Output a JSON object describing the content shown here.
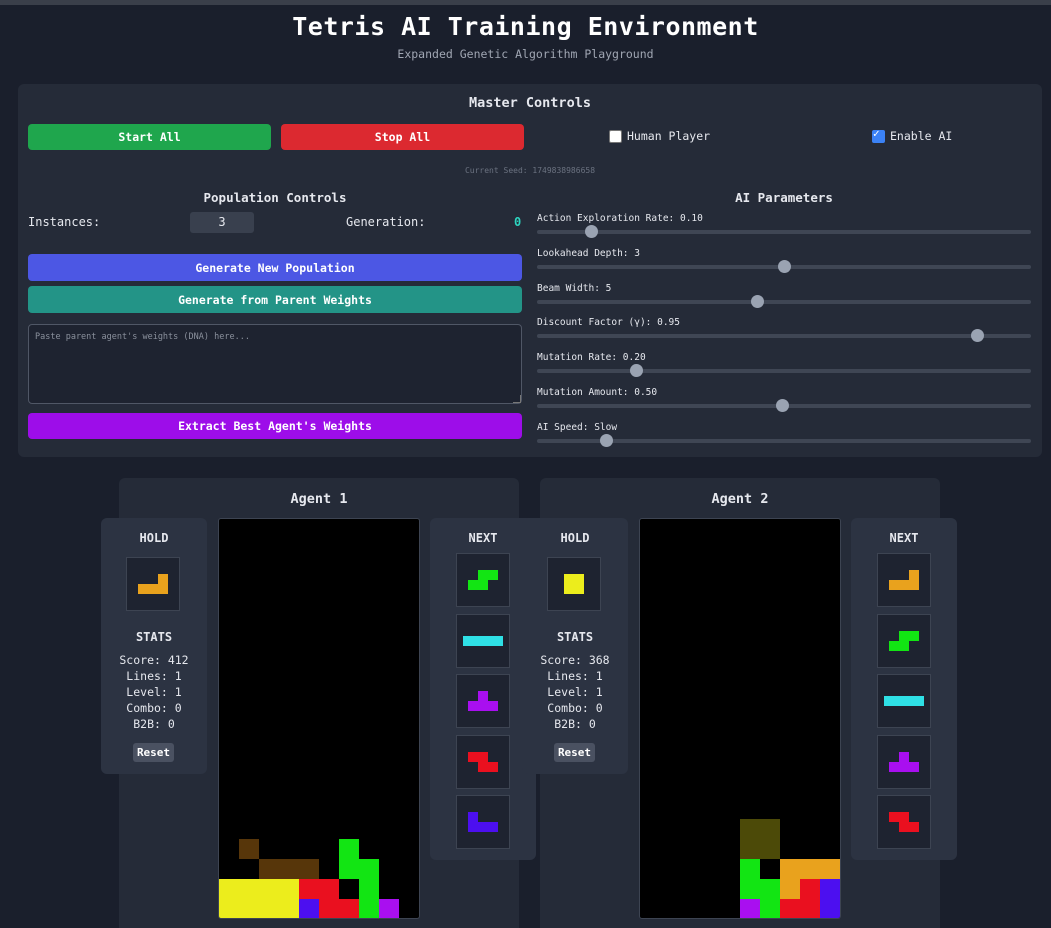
{
  "header": {
    "title": "Tetris AI Training Environment",
    "subtitle": "Expanded Genetic Algorithm Playground"
  },
  "master": {
    "title": "Master Controls",
    "start_all": "Start All",
    "stop_all": "Stop All",
    "human_player": {
      "label": "Human Player",
      "checked": false
    },
    "enable_ai": {
      "label": "Enable AI",
      "checked": true
    },
    "seed_label": "Current Seed: 1749838986658"
  },
  "population": {
    "title": "Population Controls",
    "instances_label": "Instances:",
    "instances_value": "3",
    "generation_label": "Generation:",
    "generation_value": "0",
    "generate_new": "Generate New Population",
    "generate_parent": "Generate from Parent Weights",
    "weights_placeholder": "Paste parent agent's weights (DNA) here...",
    "extract_best": "Extract Best Agent's Weights"
  },
  "ai_params": {
    "title": "AI Parameters",
    "items": [
      {
        "label": "Action Exploration Rate: 0.10",
        "fraction": 0.11
      },
      {
        "label": "Lookahead Depth: 3",
        "fraction": 0.5
      },
      {
        "label": "Beam Width: 5",
        "fraction": 0.445
      },
      {
        "label": "Discount Factor (γ): 0.95",
        "fraction": 0.89
      },
      {
        "label": "Mutation Rate: 0.20",
        "fraction": 0.2
      },
      {
        "label": "Mutation Amount: 0.50",
        "fraction": 0.495
      },
      {
        "label": "AI Speed: Slow",
        "fraction": 0.14
      }
    ]
  },
  "colors": {
    "I": "#2fe0e6",
    "O": "#eced1c",
    "T": "#a90ff0",
    "S": "#12e513",
    "Z": "#ea101f",
    "J": "#4c0ff0",
    "L": "#e9a21d",
    "ghost_brown": "#57360a",
    "ghost_olive": "#4c4a08"
  },
  "agents": [
    {
      "title": "Agent 1",
      "hold_label": "HOLD",
      "hold_piece": "L",
      "next_label": "NEXT",
      "next_pieces": [
        "S",
        "I",
        "T",
        "Z",
        "J"
      ],
      "stats_label": "STATS",
      "stats": {
        "score": "Score: 412",
        "lines": "Lines: 1",
        "level": "Level: 1",
        "combo": "Combo: 0",
        "b2b": "B2B: 0"
      },
      "reset": "Reset",
      "board": [
        [
          1,
          16,
          "ghost_brown"
        ],
        [
          2,
          17,
          "ghost_brown"
        ],
        [
          3,
          17,
          "ghost_brown"
        ],
        [
          4,
          17,
          "ghost_brown"
        ],
        [
          6,
          16,
          "S"
        ],
        [
          6,
          17,
          "S"
        ],
        [
          7,
          17,
          "S"
        ],
        [
          7,
          18,
          "S"
        ],
        [
          0,
          18,
          "O"
        ],
        [
          1,
          18,
          "O"
        ],
        [
          2,
          18,
          "O"
        ],
        [
          3,
          18,
          "O"
        ],
        [
          0,
          19,
          "O"
        ],
        [
          1,
          19,
          "O"
        ],
        [
          2,
          19,
          "O"
        ],
        [
          3,
          19,
          "O"
        ],
        [
          4,
          18,
          "Z"
        ],
        [
          5,
          18,
          "Z"
        ],
        [
          5,
          19,
          "Z"
        ],
        [
          6,
          19,
          "Z"
        ],
        [
          4,
          19,
          "J"
        ],
        [
          7,
          19,
          "S"
        ],
        [
          8,
          19,
          "T"
        ]
      ]
    },
    {
      "title": "Agent 2",
      "hold_label": "HOLD",
      "hold_piece": "O",
      "next_label": "NEXT",
      "next_pieces": [
        "L",
        "S",
        "I",
        "T",
        "Z"
      ],
      "stats_label": "STATS",
      "stats": {
        "score": "Score: 368",
        "lines": "Lines: 1",
        "level": "Level: 1",
        "combo": "Combo: 0",
        "b2b": "B2B: 0"
      },
      "reset": "Reset",
      "board": [
        [
          5,
          15,
          "ghost_olive"
        ],
        [
          6,
          15,
          "ghost_olive"
        ],
        [
          5,
          16,
          "ghost_olive"
        ],
        [
          6,
          16,
          "ghost_olive"
        ],
        [
          5,
          17,
          "S"
        ],
        [
          5,
          18,
          "S"
        ],
        [
          6,
          18,
          "S"
        ],
        [
          6,
          19,
          "S"
        ],
        [
          5,
          19,
          "T"
        ],
        [
          7,
          17,
          "L"
        ],
        [
          8,
          17,
          "L"
        ],
        [
          9,
          17,
          "L"
        ],
        [
          7,
          18,
          "L"
        ],
        [
          8,
          18,
          "Z"
        ],
        [
          7,
          19,
          "Z"
        ],
        [
          8,
          19,
          "Z"
        ],
        [
          9,
          18,
          "J"
        ],
        [
          9,
          19,
          "J"
        ]
      ]
    }
  ]
}
